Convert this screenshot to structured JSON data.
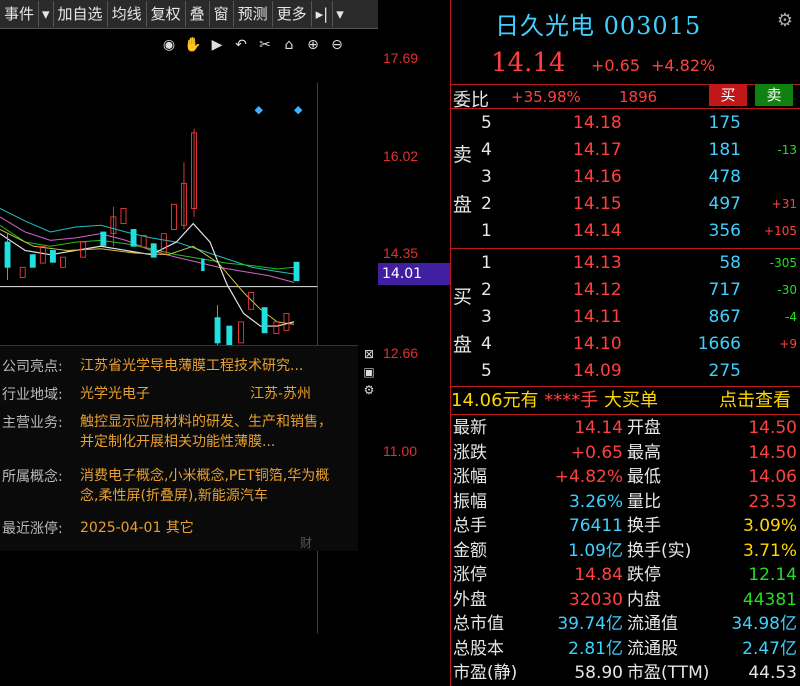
{
  "toolbar": {
    "items": [
      "事件",
      "加自选",
      "均线",
      "复权",
      "叠",
      "窗",
      "预测",
      "更多"
    ]
  },
  "chart": {
    "price_labels": [
      "17.69",
      "16.02",
      "14.35",
      "12.66",
      "11.00"
    ],
    "current_price_tag": "14.01"
  },
  "info": {
    "highlight_key": "公司亮点:",
    "highlight_val": "江苏省光学导电薄膜工程技术研究...",
    "region_key": "行业地域:",
    "industry_val": "光学光电子",
    "region_val": "江苏-苏州",
    "business_key": "主营业务:",
    "business_val": "触控显示应用材料的研发、生产和销售，并定制化开展相关功能性薄膜...",
    "concept_key": "所属概念:",
    "concept_val": "消费电子概念,小米概念,PET铜箔,华为概念,柔性屏(折叠屏),新能源汽车",
    "limit_key": "最近涨停:",
    "limit_val": "2025-04-01 其它",
    "footer": "财"
  },
  "stock": {
    "name_code": "日久光电 003015",
    "price": "14.14",
    "change": "+0.65",
    "change_pct": "+4.82%",
    "webi_label": "委比",
    "webi_pct": "+35.98%",
    "webi_diff": "1896",
    "buy_btn": "买",
    "sell_btn": "卖"
  },
  "orderbook": {
    "sell_chars": [
      "卖",
      "盘"
    ],
    "buy_chars": [
      "买",
      "盘"
    ],
    "sells": [
      {
        "lvl": "5",
        "price": "14.18",
        "vol": "175",
        "chg": ""
      },
      {
        "lvl": "4",
        "price": "14.17",
        "vol": "181",
        "chg": "-13"
      },
      {
        "lvl": "3",
        "price": "14.16",
        "vol": "478",
        "chg": ""
      },
      {
        "lvl": "2",
        "price": "14.15",
        "vol": "497",
        "chg": "+31"
      },
      {
        "lvl": "1",
        "price": "14.14",
        "vol": "356",
        "chg": "+105"
      }
    ],
    "buys": [
      {
        "lvl": "1",
        "price": "14.13",
        "vol": "58",
        "chg": "-305"
      },
      {
        "lvl": "2",
        "price": "14.12",
        "vol": "717",
        "chg": "-30"
      },
      {
        "lvl": "3",
        "price": "14.11",
        "vol": "867",
        "chg": "-4"
      },
      {
        "lvl": "4",
        "price": "14.10",
        "vol": "1666",
        "chg": "+9"
      },
      {
        "lvl": "5",
        "price": "14.09",
        "vol": "275",
        "chg": ""
      }
    ]
  },
  "bigbuy": {
    "price": "14.06",
    "text1": "元有",
    "masked": "****手",
    "text2": "大买单",
    "link": "点击查看"
  },
  "stats": [
    {
      "k1": "最新",
      "v1": "14.14",
      "c1": "red",
      "k2": "开盘",
      "v2": "14.50",
      "c2": "red"
    },
    {
      "k1": "涨跌",
      "v1": "+0.65",
      "c1": "red",
      "k2": "最高",
      "v2": "14.50",
      "c2": "red"
    },
    {
      "k1": "涨幅",
      "v1": "+4.82%",
      "c1": "red",
      "k2": "最低",
      "v2": "14.06",
      "c2": "red"
    },
    {
      "k1": "振幅",
      "v1": "3.26%",
      "c1": "cyan",
      "k2": "量比",
      "v2": "23.53",
      "c2": "red"
    },
    {
      "k1": "总手",
      "v1": "76411",
      "c1": "cyan",
      "k2": "换手",
      "v2": "3.09%",
      "c2": "yellow"
    },
    {
      "k1": "金额",
      "v1": "1.09亿",
      "c1": "cyan",
      "k2": "换手(实)",
      "v2": "3.71%",
      "c2": "yellow"
    },
    {
      "k1": "涨停",
      "v1": "14.84",
      "c1": "red",
      "k2": "跌停",
      "v2": "12.14",
      "c2": "green"
    },
    {
      "k1": "外盘",
      "v1": "32030",
      "c1": "red",
      "k2": "内盘",
      "v2": "44381",
      "c2": "green"
    },
    {
      "k1": "总市值",
      "v1": "39.74亿",
      "c1": "cyan",
      "k2": "流通值",
      "v2": "34.98亿",
      "c2": "cyan"
    },
    {
      "k1": "总股本",
      "v1": "2.81亿",
      "c1": "cyan",
      "k2": "流通股",
      "v2": "2.47亿",
      "c2": "cyan"
    },
    {
      "k1": "市盈(静)",
      "v1": "58.90",
      "c1": "white",
      "k2": "市盈(TTM)",
      "v2": "44.53",
      "c2": "white"
    }
  ]
}
